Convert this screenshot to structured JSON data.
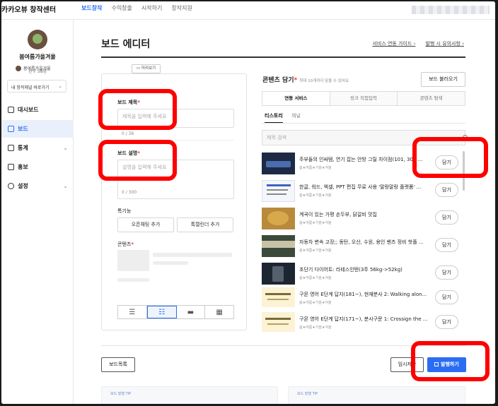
{
  "topbar": {
    "logo": "카카오뷰 창작센터",
    "nav": [
      "보드창작",
      "수익창출",
      "시작하기",
      "창작지원"
    ]
  },
  "sidebar": {
    "channel_name": "봄여름가을겨울",
    "friends": "친구 58명",
    "channel_select": "내 창작채널 바로가기",
    "items": [
      {
        "label": "대시보드",
        "icon": "dashboard-icon"
      },
      {
        "label": "보드",
        "icon": "board-icon",
        "active": true
      },
      {
        "label": "통계",
        "icon": "stats-icon"
      },
      {
        "label": "홍보",
        "icon": "megaphone-icon"
      },
      {
        "label": "설정",
        "icon": "gear-icon"
      }
    ]
  },
  "page": {
    "title": "보드 에디터",
    "links": [
      "서비스 연동 가이드 ›",
      "발행 시 유의사항 ›"
    ]
  },
  "editor": {
    "preview_channel": "봄여름가을겨울",
    "preview_button": "미리보기",
    "title_label": "보드 제목",
    "title_placeholder": "제목을 입력해 주세요",
    "title_count": "0 / 36",
    "desc_label": "보드 설명",
    "desc_placeholder": "설명을 입력해 주세요",
    "desc_count": "0 / 300",
    "special_label": "특기능",
    "open_chat_button": "오픈채팅 추가",
    "talk_calendar_button": "톡캘린더 추가",
    "contents_label": "콘텐츠"
  },
  "contents": {
    "title": "콘텐츠 담기",
    "subtitle": "최대 10개까지 담을 수 있어요",
    "load_button": "보드 불러오기",
    "tabs": [
      "연동 서비스",
      "링크 직접입력",
      "콘텐츠 탐색"
    ],
    "subtabs": [
      "티스토리",
      "채널"
    ],
    "search_placeholder": "제목 검색",
    "add_label": "담기",
    "items": [
      {
        "title": "주부들의 인싸템, 연기 잡는 안방 그릴 차이점(101, 301 ...",
        "meta": "봄★여름★가을★겨울"
      },
      {
        "title": "한글, 워드, 엑셀, PPT 편집 무료 사용 '말랑말랑 플랫폼' ...",
        "meta": "봄★여름★가을★겨울"
      },
      {
        "title": "계곡이 있는 가평 손두부, 닭갈비 맛집",
        "meta": "봄★여름★가을★겨울"
      },
      {
        "title": "자동차 변속 고장;; 동탄, 오산, 수원, 용인 벤츠 정비 핫플 ...",
        "meta": "봄★여름★가을★겨울"
      },
      {
        "title": "초단기 다이어트: 라테스인텐(3주 56kg->52kg)",
        "meta": "봄★여름★가을★겨울"
      },
      {
        "title": "구몬 영어 E단계 답지(181~), 현재분사 2: Walking alon...",
        "meta": "봄★여름★가을★겨울"
      },
      {
        "title": "구몬 영어 E단계 답지(171~), 분사구문 1: Crossign the ...",
        "meta": "봄★여름★가을★겨울"
      }
    ]
  },
  "footer": {
    "list_button": "보드목록",
    "temp_button": "임시저장",
    "publish_button": "발행하기",
    "tips": [
      "보드 발행 TIP",
      "보드 발행 TIP"
    ]
  },
  "colors": {
    "accent": "#2a6df4",
    "highlight": "#ff0000"
  }
}
